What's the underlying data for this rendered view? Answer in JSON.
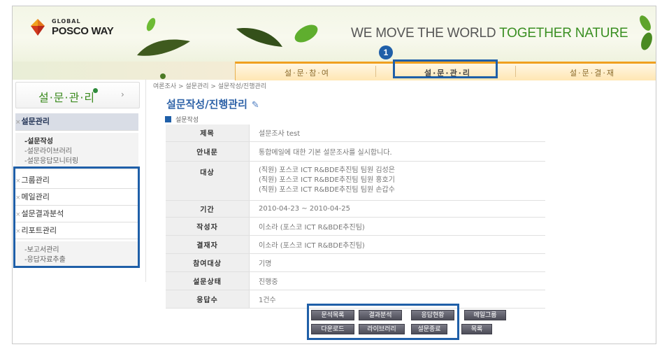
{
  "header": {
    "logo_small": "GLOBAL",
    "logo_big": "POSCO WAY",
    "slogan_plain": "WE MOVE THE WORLD ",
    "slogan_accent": "TOGETHER NATURE"
  },
  "topnav": {
    "items": [
      "설·문·참·여",
      "설·문·관·리",
      "설·문·결·재"
    ],
    "callout": "1"
  },
  "sidebar": {
    "title": "설·문·관·리",
    "arrow": "›",
    "marker": "×",
    "groups": [
      {
        "label": "설문관리",
        "subs": [
          "-설문작성",
          "-설문라이브러리",
          "-설문응답모니터링"
        ]
      },
      {
        "label": "그룹관리"
      },
      {
        "label": "메일관리"
      },
      {
        "label": "설문결과분석"
      },
      {
        "label": "리포트관리",
        "subs": [
          "-보고서관리",
          "-응답자료추출"
        ]
      }
    ]
  },
  "breadcrumb": "여론조사 > 설문관리 > 설문작성/진행관리",
  "page_title": "설문작성/진행관리",
  "section_label": "설문작성",
  "form": {
    "rows": [
      {
        "label": "제목",
        "value": "설문조사 test"
      },
      {
        "label": "안내문",
        "value": "통합메일에 대한 기본 설문조사를 실시합니다."
      },
      {
        "label": "대상",
        "lines": [
          "(직원) 포스코 ICT R&BDE추진팀 팀원 김성은",
          "(직원) 포스코 ICT R&BDE추진팀 팀원 홍호기",
          "(직원) 포스코 ICT R&BDE추진팀 팀원 손갑수"
        ]
      },
      {
        "label": "기간",
        "value": "2010-04-23 ~ 2010-04-25"
      },
      {
        "label": "작성자",
        "value": "이소라 (포스코 ICT R&BDE추진팀)"
      },
      {
        "label": "결재자",
        "value": "이소라 (포스코 ICT R&BDE추진팀)"
      },
      {
        "label": "참여대상",
        "value": "기명"
      },
      {
        "label": "설문상태",
        "value": "진행중"
      },
      {
        "label": "응답수",
        "value": "1건수"
      }
    ]
  },
  "buttons": {
    "row1": [
      "문석목록",
      "결과분석",
      "응답현황",
      "메일그룹"
    ],
    "row2": [
      "다운로드",
      "라이브러리",
      "설문종료",
      "목록"
    ]
  },
  "colors": {
    "accent_green": "#3a8f22",
    "highlight_blue": "#1f5fa8",
    "title_blue": "#2f63a8"
  }
}
